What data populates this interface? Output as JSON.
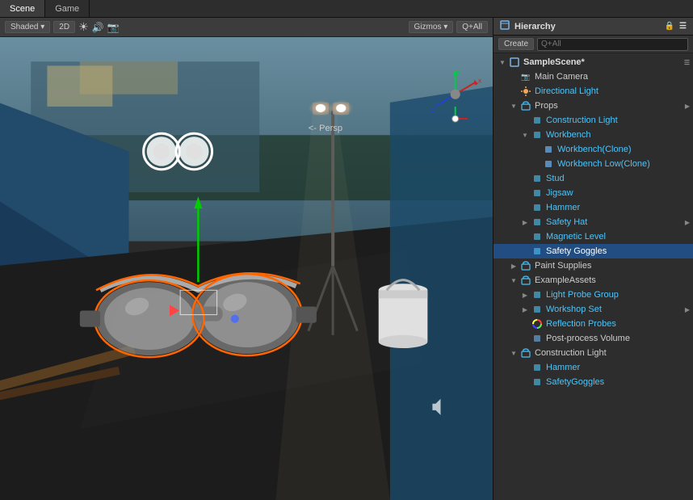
{
  "tabs": [
    {
      "label": "Scene",
      "active": true
    },
    {
      "label": "Game",
      "active": false
    }
  ],
  "viewport": {
    "shading_mode": "Shaded",
    "is_2d": false,
    "toggle_2d": "2D",
    "gizmos_label": "Gizmos",
    "gizmos_dropdown": "Q+All",
    "persp_label": "<- Persp",
    "icons": [
      "sun-icon",
      "speaker-icon",
      "camera-icon"
    ]
  },
  "hierarchy": {
    "title": "Hierarchy",
    "create_label": "Create",
    "search_placeholder": "Q+All",
    "scene_name": "SampleScene*",
    "items": [
      {
        "id": "main-camera",
        "label": "Main Camera",
        "indent": 1,
        "arrow": "",
        "icon": "camera",
        "expand": false,
        "selected": false
      },
      {
        "id": "directional-light",
        "label": "Directional Light",
        "indent": 1,
        "arrow": "",
        "icon": "light",
        "expand": false,
        "selected": false
      },
      {
        "id": "props",
        "label": "Props",
        "indent": 1,
        "arrow": "▶",
        "icon": "folder",
        "expand": true,
        "selected": false
      },
      {
        "id": "construction-light-1",
        "label": "Construction Light",
        "indent": 2,
        "arrow": "",
        "icon": "prefab",
        "expand": false,
        "selected": false
      },
      {
        "id": "workbench",
        "label": "Workbench",
        "indent": 2,
        "arrow": "▼",
        "icon": "prefab",
        "expand": true,
        "selected": false
      },
      {
        "id": "workbench-clone",
        "label": "Workbench(Clone)",
        "indent": 3,
        "arrow": "",
        "icon": "gameobj",
        "expand": false,
        "selected": false
      },
      {
        "id": "workbench-low-clone",
        "label": "Workbench Low(Clone)",
        "indent": 3,
        "arrow": "",
        "icon": "gameobj",
        "expand": false,
        "selected": false
      },
      {
        "id": "stud",
        "label": "Stud",
        "indent": 2,
        "arrow": "",
        "icon": "prefab",
        "expand": false,
        "selected": false
      },
      {
        "id": "jigsaw",
        "label": "Jigsaw",
        "indent": 2,
        "arrow": "",
        "icon": "prefab",
        "expand": false,
        "selected": false
      },
      {
        "id": "hammer-1",
        "label": "Hammer",
        "indent": 2,
        "arrow": "",
        "icon": "prefab",
        "expand": false,
        "selected": false
      },
      {
        "id": "safety-hat",
        "label": "Safety Hat",
        "indent": 2,
        "arrow": "▶",
        "icon": "prefab",
        "expand": false,
        "selected": false
      },
      {
        "id": "magnetic-level",
        "label": "Magnetic Level",
        "indent": 2,
        "arrow": "",
        "icon": "prefab",
        "expand": false,
        "selected": false
      },
      {
        "id": "safety-goggles",
        "label": "Safety Goggles",
        "indent": 2,
        "arrow": "",
        "icon": "prefab",
        "expand": false,
        "selected": true
      },
      {
        "id": "paint-supplies",
        "label": "Paint Supplies",
        "indent": 1,
        "arrow": "▶",
        "icon": "folder",
        "expand": false,
        "selected": false
      },
      {
        "id": "example-assets",
        "label": "ExampleAssets",
        "indent": 1,
        "arrow": "▼",
        "icon": "folder",
        "expand": true,
        "selected": false
      },
      {
        "id": "light-probe-group",
        "label": "Light Probe Group",
        "indent": 2,
        "arrow": "▶",
        "icon": "prefab",
        "expand": false,
        "selected": false
      },
      {
        "id": "workshop-set",
        "label": "Workshop Set",
        "indent": 2,
        "arrow": "▶",
        "icon": "prefab",
        "expand": false,
        "selected": false
      },
      {
        "id": "reflection-probes",
        "label": "Reflection Probes",
        "indent": 2,
        "arrow": "",
        "icon": "prefab",
        "expand": false,
        "selected": false
      },
      {
        "id": "post-process-volume",
        "label": "Post-process Volume",
        "indent": 2,
        "arrow": "",
        "icon": "gameobj",
        "expand": false,
        "selected": false
      },
      {
        "id": "construction-light-2",
        "label": "Construction Light",
        "indent": 1,
        "arrow": "▼",
        "icon": "folder",
        "expand": true,
        "selected": false
      },
      {
        "id": "hammer-2",
        "label": "Hammer",
        "indent": 2,
        "arrow": "",
        "icon": "prefab",
        "expand": false,
        "selected": false
      },
      {
        "id": "safety-goggles-2",
        "label": "SafetyGoggles",
        "indent": 2,
        "arrow": "",
        "icon": "prefab",
        "expand": false,
        "selected": false
      }
    ]
  },
  "colors": {
    "selected_bg": "#214d82",
    "panel_bg": "#2d2d2d",
    "toolbar_bg": "#3c3c3c",
    "camera_icon": "#6db3f2",
    "light_icon": "#f2a65a",
    "prefab_icon": "#4fc3f7",
    "folder_icon": "#e8c55a"
  }
}
